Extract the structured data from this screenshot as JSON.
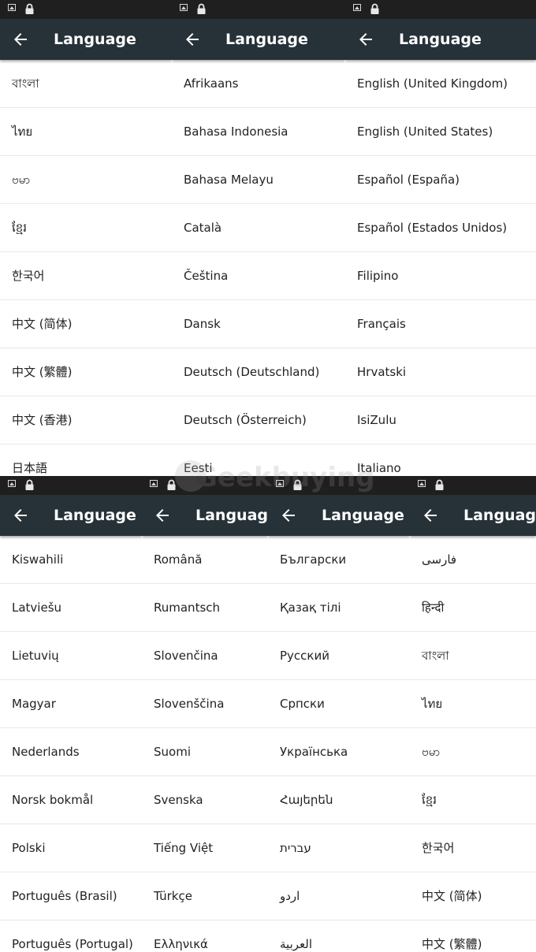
{
  "screen_title": "Language",
  "watermark": "Geekbuying",
  "panels": [
    {
      "items": [
        "বাংলা",
        "ไทย",
        "ဗမာ",
        "ខ្មែរ",
        "한국어",
        "中文 (简体)",
        "中文 (繁體)",
        "中文 (香港)",
        "日本語"
      ]
    },
    {
      "items": [
        "Afrikaans",
        "Bahasa Indonesia",
        "Bahasa Melayu",
        "Català",
        "Čeština",
        "Dansk",
        "Deutsch (Deutschland)",
        "Deutsch (Österreich)",
        "Eesti"
      ]
    },
    {
      "items": [
        "English (United Kingdom)",
        "English (United States)",
        "Español (España)",
        "Español (Estados Unidos)",
        "Filipino",
        "Français",
        "Hrvatski",
        "IsiZulu",
        "Italiano"
      ]
    },
    {
      "items": [
        "Kiswahili",
        "Latviešu",
        "Lietuvių",
        "Magyar",
        "Nederlands",
        "Norsk bokmål",
        "Polski",
        "Português (Brasil)",
        "Português (Portugal)"
      ]
    },
    {
      "items": [
        "Română",
        "Rumantsch",
        "Slovenčina",
        "Slovenščina",
        "Suomi",
        "Svenska",
        "Tiếng Việt",
        "Türkçe",
        "Ελληνικά"
      ]
    },
    {
      "items": [
        "Български",
        "Қазақ тілі",
        "Русский",
        "Српски",
        "Українська",
        "Հայերեն",
        "עברית",
        "اردو",
        "العربية"
      ]
    },
    {
      "items": [
        "فارسی",
        "हिन्दी",
        "বাংলা",
        "ไทย",
        "ဗမာ",
        "ខ្មែរ",
        "한국어",
        "中文 (简体)",
        "中文 (繁體)"
      ]
    }
  ],
  "colors": {
    "toolbar": "#263238",
    "status_bar": "#1f1f1f",
    "text": "#222222",
    "divider": "#e8e8e8"
  },
  "icons": {
    "back": "arrow-left-icon",
    "status_image": "image-notification-icon",
    "status_lock": "lock-icon"
  }
}
